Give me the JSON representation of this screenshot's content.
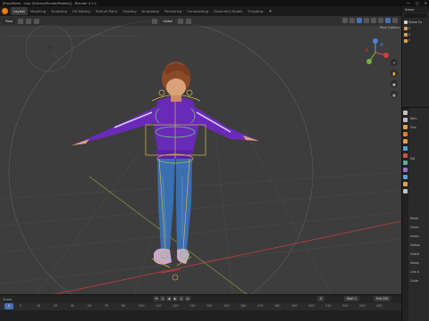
{
  "window": {
    "title": "[ProxiModo - Cojo (Edicion/Mundo/Modelo)] - Blender 4.1.1",
    "minimize": "—",
    "maximize": "□",
    "close": "✕"
  },
  "menubar": {
    "tabs": [
      {
        "label": "Layout",
        "active": true
      },
      {
        "label": "Modeling"
      },
      {
        "label": "Sculpting"
      },
      {
        "label": "UV Editing"
      },
      {
        "label": "Texture Paint"
      },
      {
        "label": "Shading"
      },
      {
        "label": "Animation"
      },
      {
        "label": "Rendering"
      },
      {
        "label": "Compositing"
      },
      {
        "label": "Geometry Nodes"
      },
      {
        "label": "Scripting"
      }
    ],
    "add_tab": "+"
  },
  "viewport": {
    "mode": "Pose",
    "transform_orientation": "Global",
    "pose_options": "Pose Options",
    "zoom_icon": "+",
    "pan_icon": "✋",
    "camera_icon": "▣",
    "grid_icon": "▦"
  },
  "outliner": {
    "title": "Scene",
    "rows": [
      {
        "label": "Scene Co",
        "color": "#cfcfcf"
      },
      {
        "label": "C",
        "color": "#e0a050"
      },
      {
        "label": "C",
        "color": "#e0a050"
      },
      {
        "label": "T",
        "color": "#e0a050"
      }
    ]
  },
  "timeline": {
    "label": "Scene",
    "current_frame": "0",
    "start_label": "Start",
    "start_value": "1",
    "end_label": "End",
    "end_value": "250",
    "ticks": [
      "0",
      "10",
      "20",
      "40",
      "50",
      "70",
      "80",
      "100",
      "110",
      "120",
      "130",
      "140",
      "150",
      "160",
      "170",
      "180",
      "190",
      "200",
      "210",
      "220",
      "230",
      "240"
    ]
  },
  "properties": {
    "rows": [
      "Nam",
      "Tran",
      "Dei",
      "Relati",
      "Collec",
      "Instan",
      "Motion",
      "Visibili",
      "Viewp",
      "Line A",
      "Custo"
    ],
    "tab_colors": [
      "#c0c0c0",
      "#c0c0c0",
      "#e0a050",
      "#e57a3a",
      "#e0a050",
      "#5a9fd4",
      "#d34a4a",
      "#5ab0a0",
      "#9c6fd4",
      "#5a9fd4",
      "#e0a050",
      "#c0c0c0"
    ]
  }
}
